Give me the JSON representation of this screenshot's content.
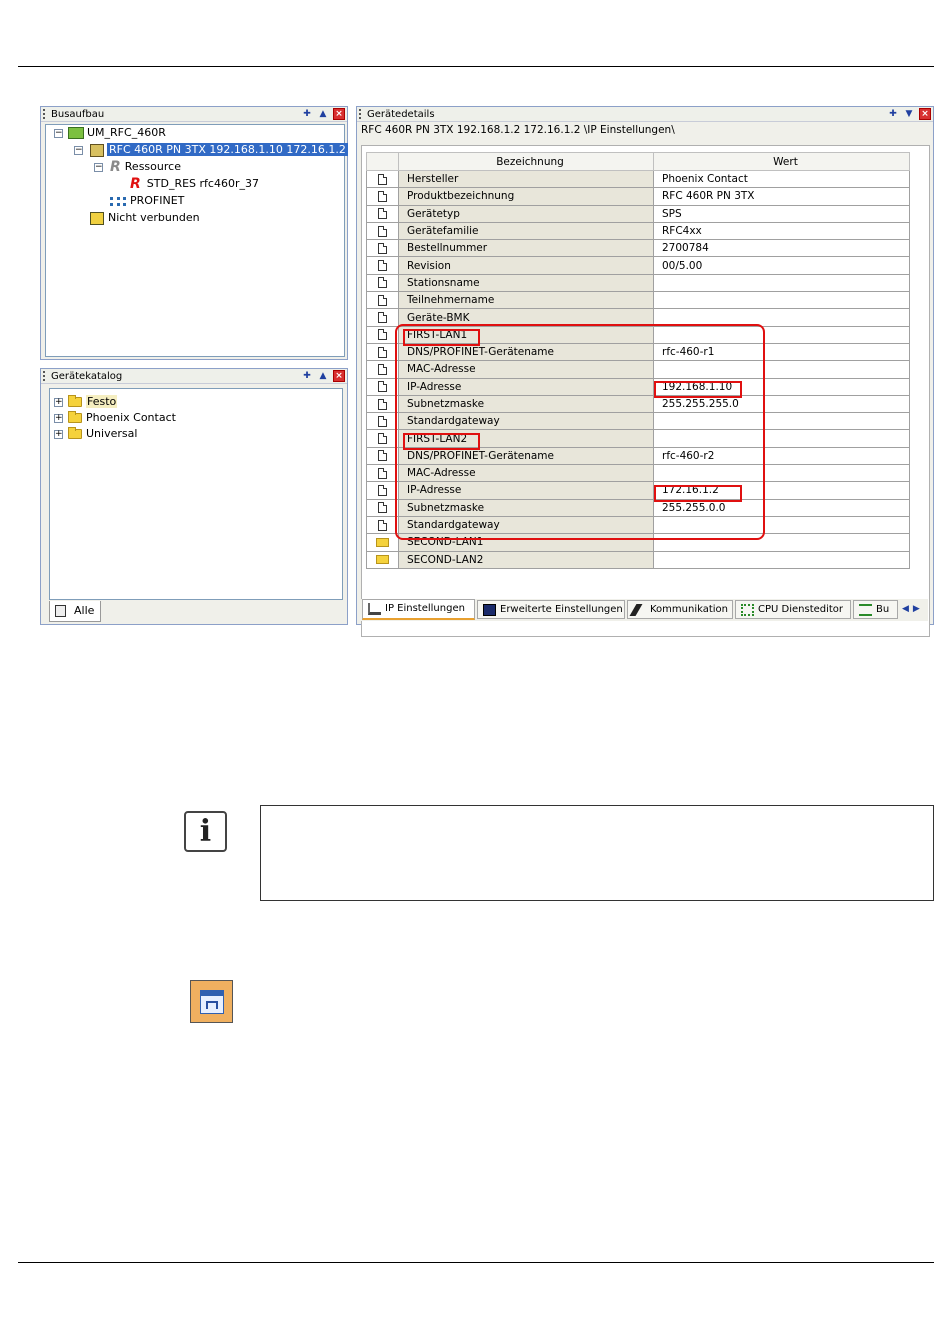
{
  "bus_panel": {
    "title": "Busaufbau",
    "tree": [
      {
        "label": "UM_RFC_460R"
      },
      {
        "label": "RFC 460R PN 3TX 192.168.1.10 172.16.1.2"
      },
      {
        "label": "Ressource"
      },
      {
        "label": "STD_RES rfc460r_37"
      },
      {
        "label": "PROFINET"
      },
      {
        "label": "Nicht verbunden"
      }
    ]
  },
  "catalog_panel": {
    "title": "Gerätekatalog",
    "tree": [
      {
        "label": "Festo"
      },
      {
        "label": "Phoenix Contact"
      },
      {
        "label": "Universal"
      }
    ],
    "tab_label": "Alle"
  },
  "details_panel": {
    "title": "Gerätedetails",
    "path": "RFC 460R PN 3TX 192.168.1.2 172.16.1.2 \\IP Einstellungen\\",
    "columns": [
      "Bezeichnung",
      "Wert"
    ],
    "rows": [
      {
        "name": "Hersteller",
        "value": "Phoenix Contact"
      },
      {
        "name": "Produktbezeichnung",
        "value": "RFC 460R PN 3TX"
      },
      {
        "name": "Gerätetyp",
        "value": "SPS"
      },
      {
        "name": "Gerätefamilie",
        "value": "RFC4xx"
      },
      {
        "name": "Bestellnummer",
        "value": "2700784"
      },
      {
        "name": "Revision",
        "value": "00/5.00"
      },
      {
        "name": "Stationsname",
        "value": ""
      },
      {
        "name": "Teilnehmername",
        "value": ""
      },
      {
        "name": "Geräte-BMK",
        "value": ""
      },
      {
        "name": "FIRST-LAN1",
        "value": ""
      },
      {
        "name": "DNS/PROFINET-Gerätename",
        "value": "rfc-460-r1"
      },
      {
        "name": "MAC-Adresse",
        "value": ""
      },
      {
        "name": "IP-Adresse",
        "value": "192.168.1.10"
      },
      {
        "name": "Subnetzmaske",
        "value": "255.255.255.0"
      },
      {
        "name": "Standardgateway",
        "value": ""
      },
      {
        "name": "FIRST-LAN2",
        "value": ""
      },
      {
        "name": "DNS/PROFINET-Gerätename",
        "value": "rfc-460-r2"
      },
      {
        "name": "MAC-Adresse",
        "value": ""
      },
      {
        "name": "IP-Adresse",
        "value": "172.16.1.2"
      },
      {
        "name": "Subnetzmaske",
        "value": "255.255.0.0"
      },
      {
        "name": "Standardgateway",
        "value": ""
      },
      {
        "name": "SECOND-LAN1",
        "value": ""
      },
      {
        "name": "SECOND-LAN2",
        "value": ""
      }
    ],
    "tabs": [
      {
        "label": "IP Einstellungen"
      },
      {
        "label": "Erweiterte Einstellungen"
      },
      {
        "label": "Kommunikation"
      },
      {
        "label": "CPU Diensteditor"
      },
      {
        "label": "Bu"
      }
    ]
  },
  "colors": {
    "selection": "#316ac5",
    "highlight_red": "#e01010",
    "panel_border": "#8ca0c8"
  }
}
